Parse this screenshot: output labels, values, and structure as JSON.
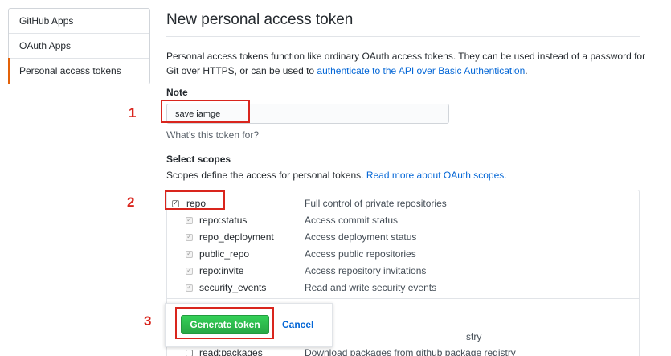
{
  "sidebar": {
    "items": [
      {
        "label": "GitHub Apps"
      },
      {
        "label": "OAuth Apps"
      },
      {
        "label": "Personal access tokens",
        "selected": true
      }
    ]
  },
  "main": {
    "title": "New personal access token",
    "intro_text": "Personal access tokens function like ordinary OAuth access tokens. They can be used instead of a password for Git over HTTPS, or can be used to ",
    "intro_link": "authenticate to the API over Basic Authentication",
    "intro_end": ".",
    "note": {
      "label": "Note",
      "value": "save iamge",
      "hint": "What's this token for?"
    },
    "scopes": {
      "title": "Select scopes",
      "desc": "Scopes define the access for personal tokens. ",
      "desc_link": "Read more about OAuth scopes.",
      "items": [
        {
          "name": "repo",
          "desc": "Full control of private repositories",
          "checked": true
        },
        {
          "name": "repo:status",
          "desc": "Access commit status",
          "checked": true
        },
        {
          "name": "repo_deployment",
          "desc": "Access deployment status",
          "checked": true
        },
        {
          "name": "public_repo",
          "desc": "Access public repositories",
          "checked": true
        },
        {
          "name": "repo:invite",
          "desc": "Access repository invitations",
          "checked": true
        },
        {
          "name": "security_events",
          "desc": "Read and write security events",
          "checked": true
        }
      ],
      "hidden_partial": {
        "partial_desc_1": "stry",
        "read_packages_name": "read:packages",
        "read_packages_desc": "Download packages from github package registry"
      }
    },
    "actions": {
      "generate_label": "Generate token",
      "cancel_label": "Cancel"
    }
  },
  "annotations": {
    "labels": [
      "1",
      "2",
      "3"
    ],
    "color": "#d9251d"
  },
  "colors": {
    "primary_button": "#28a745",
    "link": "#0366d6",
    "selected_accent": "#e36209"
  }
}
